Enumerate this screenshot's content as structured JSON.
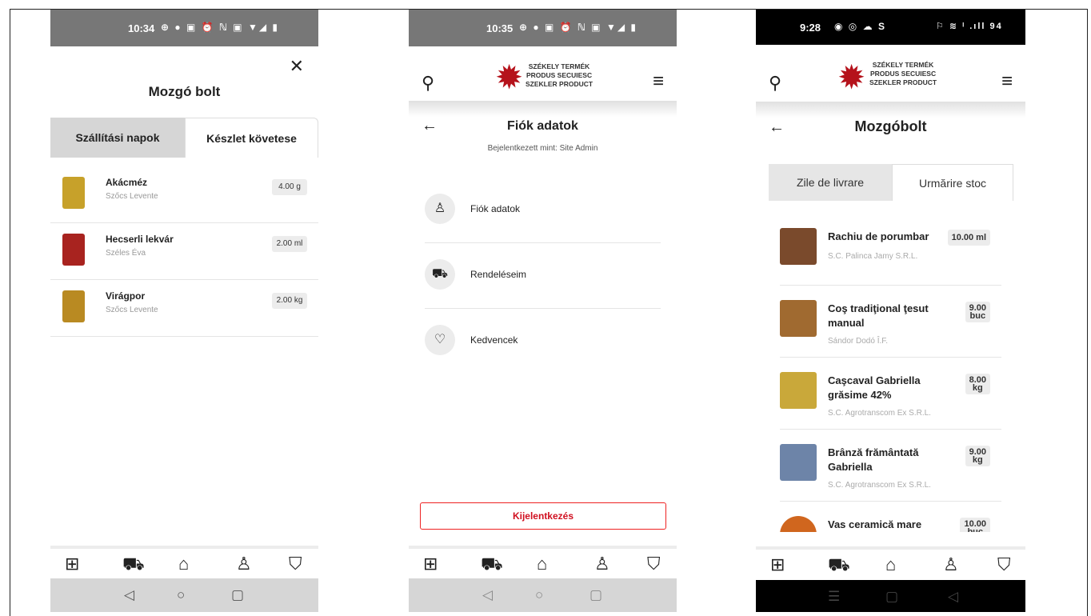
{
  "screen1": {
    "status": {
      "time": "10:34",
      "icons": "⊕ ● ▣     ⏰ ℕ ▣ ▼◢ ▮"
    },
    "title": "Mozgó bolt",
    "tabs": [
      {
        "label": "Szállítási napok"
      },
      {
        "label": "Készlet követese"
      }
    ],
    "products": [
      {
        "name": "Akácméz",
        "seller": "Szőcs Levente",
        "qty": "4.00 g",
        "thumb_color": "#c7a12a"
      },
      {
        "name": "Hecserli lekvár",
        "seller": "Széles Éva",
        "qty": "2.00 ml",
        "thumb_color": "#a8231f"
      },
      {
        "name": "Virágpor",
        "seller": "Szőcs Levente",
        "qty": "2.00 kg",
        "thumb_color": "#b98a22"
      }
    ]
  },
  "screen2": {
    "status": {
      "time": "10:35",
      "icons": "⊕ ● ▣     ⏰ ℕ ▣ ▼◢ ▮"
    },
    "logo": {
      "line1": "SZÉKELY TERMÉK",
      "line2": "PRODUS SECUIESC",
      "line3": "SZEKLER PRODUCT"
    },
    "title": "Fiók adatok",
    "subtitle": "Bejelentkezett mint: Site Admin",
    "menu": [
      {
        "label": "Fiók adatok",
        "icon": "user-icon"
      },
      {
        "label": "Rendeléseim",
        "icon": "truck-icon"
      },
      {
        "label": "Kedvencek",
        "icon": "heart-icon"
      }
    ],
    "logout": "Kijelentkezés"
  },
  "screen3": {
    "status": {
      "time": "9:28",
      "icons_left": "◉ ◎ ☁ S",
      "icons_right": "⚐ ≋ ᴵ .ıll 94"
    },
    "logo": {
      "line1": "SZÉKELY TERMÉK",
      "line2": "PRODUS SECUIESC",
      "line3": "SZEKLER PRODUCT"
    },
    "title": "Mozgóbolt",
    "tabs": [
      {
        "label": "Zile de livrare"
      },
      {
        "label": "Urmărire stoc"
      }
    ],
    "products": [
      {
        "name": "Rachiu de porumbar",
        "seller": "S.C. Palinca Jamy S.R.L.",
        "qty_value": "10.00 ml",
        "qty_unit": "",
        "thumb_color": "#7a4a2c"
      },
      {
        "name": "Coş tradiţional ţesut manual",
        "seller": "Sándor Dodó Î.F.",
        "qty_value": "9.00",
        "qty_unit": "buc",
        "thumb_color": "#a06a30"
      },
      {
        "name": "Caşcaval Gabriella grăsime 42%",
        "seller": "S.C. Agrotranscom Ex S.R.L.",
        "qty_value": "8.00",
        "qty_unit": "kg",
        "thumb_color": "#c9a83a"
      },
      {
        "name": "Brânză frământată Gabriella",
        "seller": "S.C. Agrotranscom Ex S.R.L.",
        "qty_value": "9.00",
        "qty_unit": "kg",
        "thumb_color": "#6d84a8"
      },
      {
        "name": "Vas ceramică mare pentru sarmale",
        "seller": "",
        "qty_value": "10.00",
        "qty_unit": "buc",
        "thumb_color": "#d0661e"
      }
    ]
  },
  "icons": {
    "search": "search-icon",
    "menu": "hamburger-icon",
    "close": "close-icon",
    "back": "arrow-left-icon",
    "tabbar": [
      "grid-icon",
      "truck-icon",
      "store-icon",
      "user-icon",
      "cart-icon"
    ]
  },
  "colors": {
    "accent": "#d01020",
    "logo": "#b5121b"
  }
}
